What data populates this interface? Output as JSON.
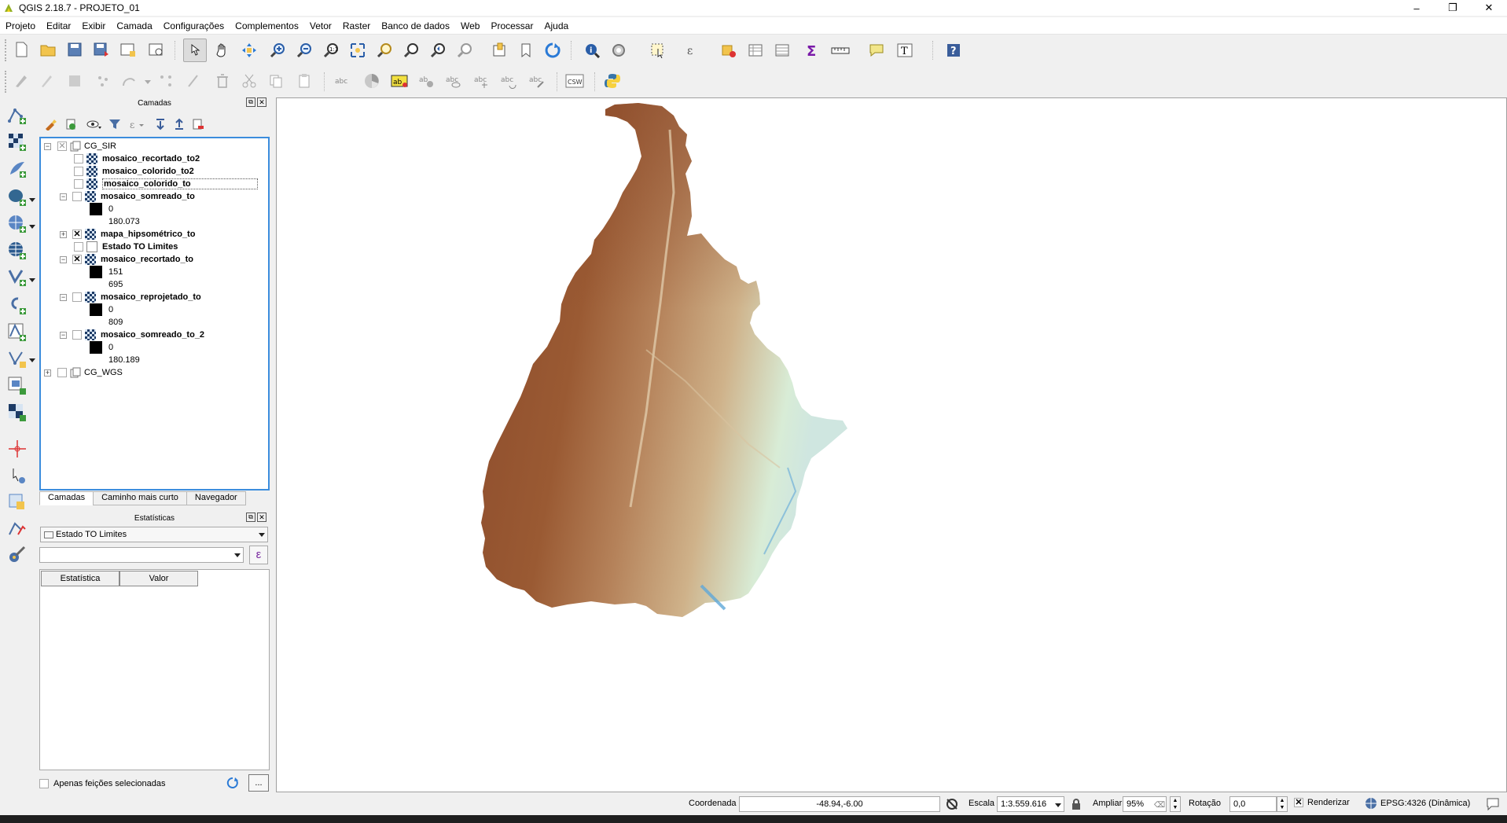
{
  "window": {
    "title": "QGIS 2.18.7 - PROJETO_01",
    "minimize": "–",
    "restore": "❐",
    "close": "✕"
  },
  "menu": [
    "Projeto",
    "Editar",
    "Exibir",
    "Camada",
    "Configurações",
    "Complementos",
    "Vetor",
    "Raster",
    "Banco de dados",
    "Web",
    "Processar",
    "Ajuda"
  ],
  "toolbar2": {
    "csw_label": "CSW",
    "abc_label": "abc"
  },
  "layers_panel": {
    "title": "Camadas",
    "groups": [
      {
        "name": "CG_SIR"
      },
      {
        "name": "CG_WGS"
      }
    ],
    "layers": [
      {
        "name": "mosaico_recortado_to2"
      },
      {
        "name": "mosaico_colorido_to2"
      },
      {
        "name": "mosaico_colorido_to"
      },
      {
        "name": "mosaico_somreado_to",
        "legend": [
          "0",
          "180.073"
        ]
      },
      {
        "name": "mapa_hipsométrico_to"
      },
      {
        "name": "Estado TO Limites"
      },
      {
        "name": "mosaico_recortado_to",
        "legend": [
          "151",
          "695"
        ]
      },
      {
        "name": "mosaico_reprojetado_to",
        "legend": [
          "0",
          "809"
        ]
      },
      {
        "name": "mosaico_somreado_to_2",
        "legend": [
          "0",
          "180.189"
        ]
      }
    ]
  },
  "tabs": [
    "Camadas",
    "Caminho mais curto",
    "Navegador"
  ],
  "stats_panel": {
    "title": "Estatísticas",
    "layer_select": "Estado TO Limites",
    "field_select": "",
    "expression_button": "ε",
    "columns": [
      "Estatística",
      "Valor"
    ],
    "selected_only_label": "Apenas feições selecionadas",
    "more_button": "..."
  },
  "status": {
    "coord_label": "Coordenada",
    "coord_value": "-48.94,-6.00",
    "scale_label": "Escala",
    "scale_value": "1:3.559.616",
    "zoom_label": "Ampliar",
    "zoom_value": "95%",
    "rotation_label": "Rotação",
    "rotation_value": "0,0",
    "render_label": "Renderizar",
    "crs_label": "EPSG:4326 (Dinâmica)"
  },
  "colors": {
    "accent": "#3c8ddd",
    "dem_high": "#8b4a2b",
    "dem_mid": "#c8a477",
    "dem_low": "#d8ecd6",
    "water": "#5fa7d8"
  }
}
